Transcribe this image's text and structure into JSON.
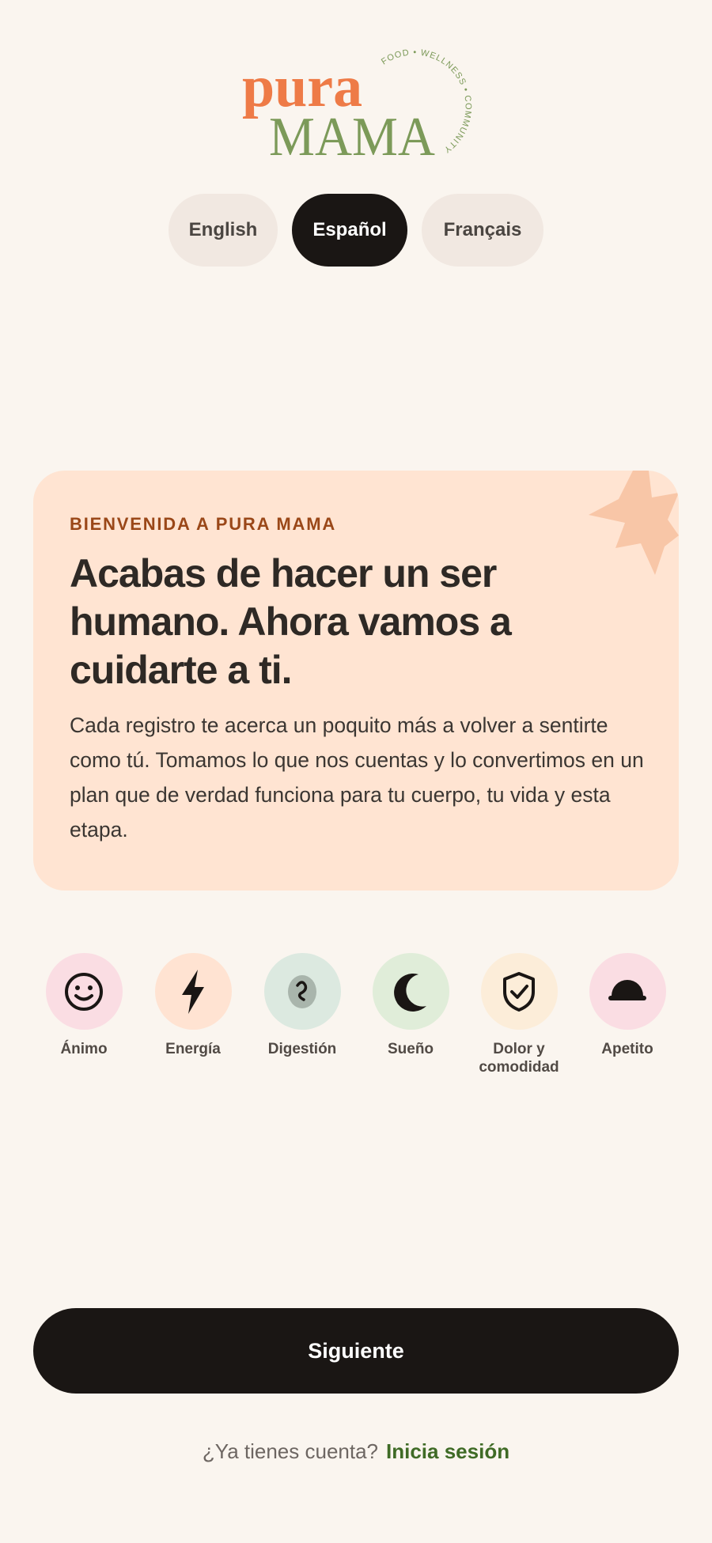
{
  "brand": {
    "name_top": "pura",
    "name_bottom": "MAMA",
    "tagline": "FOOD • WELLNESS • COMMUNITY",
    "colors": {
      "orange": "#EE7B47",
      "green": "#7C9A59"
    }
  },
  "languages": [
    {
      "label": "English",
      "selected": false
    },
    {
      "label": "Español",
      "selected": true
    },
    {
      "label": "Français",
      "selected": false
    }
  ],
  "welcome_card": {
    "eyebrow": "BIENVENIDA A PURA MAMA",
    "headline": "Acabas de hacer un ser humano. Ahora vamos a cuidarte a ti.",
    "body": "Cada registro te acerca un poquito más a volver a sentirte como tú. Tomamos lo que nos cuentas y lo convertimos en un plan que de verdad funciona para tu cuerpo, tu vida y esta etapa.",
    "bg_color": "#FFE4D2",
    "decoration": "sparkle-burst-icon"
  },
  "categories": [
    {
      "label": "Ánimo",
      "icon": "smiley-icon",
      "bg": "#FADDE3"
    },
    {
      "label": "Energía",
      "icon": "lightning-bolt-icon",
      "bg": "#FFE3D2"
    },
    {
      "label": "Digestión",
      "icon": "stomach-icon",
      "bg": "#DCE9E0"
    },
    {
      "label": "Sueño",
      "icon": "crescent-moon-icon",
      "bg": "#E0EDD9"
    },
    {
      "label": "Dolor y comodidad",
      "icon": "shield-check-icon",
      "bg": "#FCEDD9"
    },
    {
      "label": "Apetito",
      "icon": "bowl-icon",
      "bg": "#FADDE3"
    }
  ],
  "actions": {
    "next_label": "Siguiente",
    "signin_prompt": "¿Ya tienes cuenta?",
    "signin_link": "Inicia sesión"
  }
}
